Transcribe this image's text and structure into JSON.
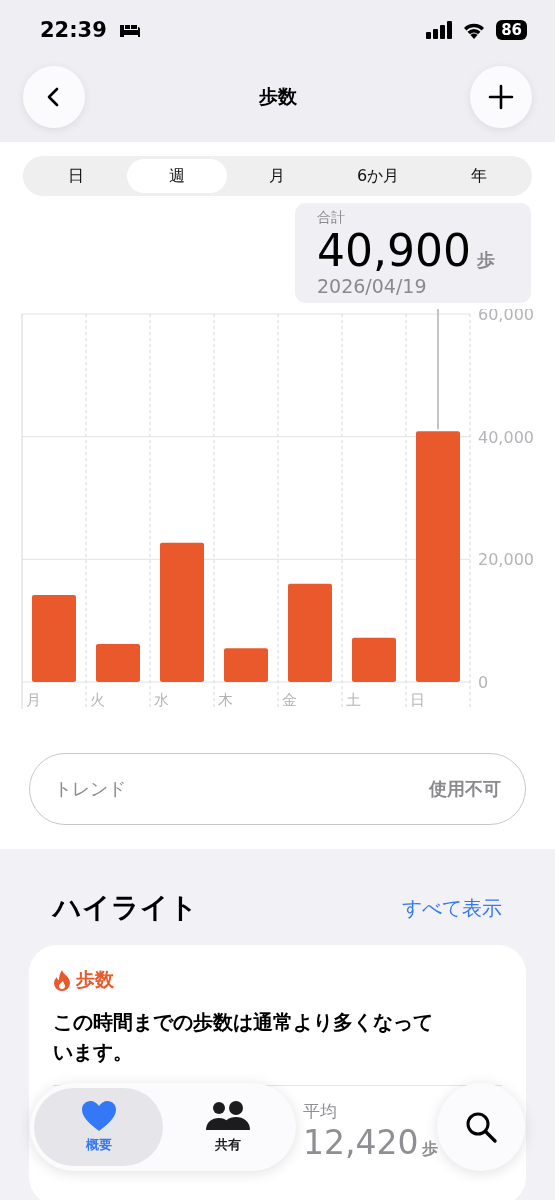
{
  "status_bar": {
    "time": "22:39",
    "battery": "86"
  },
  "nav": {
    "title": "歩数"
  },
  "segments": [
    {
      "label": "日",
      "selected": false
    },
    {
      "label": "週",
      "selected": true
    },
    {
      "label": "月",
      "selected": false
    },
    {
      "label": "6か月",
      "selected": false
    },
    {
      "label": "年",
      "selected": false
    }
  ],
  "summary": {
    "label": "合計",
    "value": "40,900",
    "unit": "歩",
    "date": "2026/04/19"
  },
  "chart_data": {
    "type": "bar",
    "categories": [
      "月",
      "火",
      "水",
      "木",
      "金",
      "土",
      "日"
    ],
    "values": [
      14200,
      6200,
      22700,
      5500,
      16000,
      7200,
      40900
    ],
    "ylim": [
      0,
      60000
    ],
    "yticks": [
      {
        "value": 0,
        "label": "0"
      },
      {
        "value": 20000,
        "label": "20,000"
      },
      {
        "value": 40000,
        "label": "40,000"
      },
      {
        "value": 60000,
        "label": "60,000"
      }
    ]
  },
  "trend": {
    "label": "トレンド",
    "value": "使用不可"
  },
  "highlights": {
    "title": "ハイライト",
    "link": "すべて表示",
    "card": {
      "category": "歩数",
      "text": "この時間までの歩数は通常より多くなっています。"
    },
    "stats": [
      {
        "label": "平均",
        "value": "12,420",
        "unit": "歩"
      }
    ]
  },
  "tab_bar": [
    {
      "label": "概要",
      "selected": true
    },
    {
      "label": "共有",
      "selected": false
    }
  ]
}
